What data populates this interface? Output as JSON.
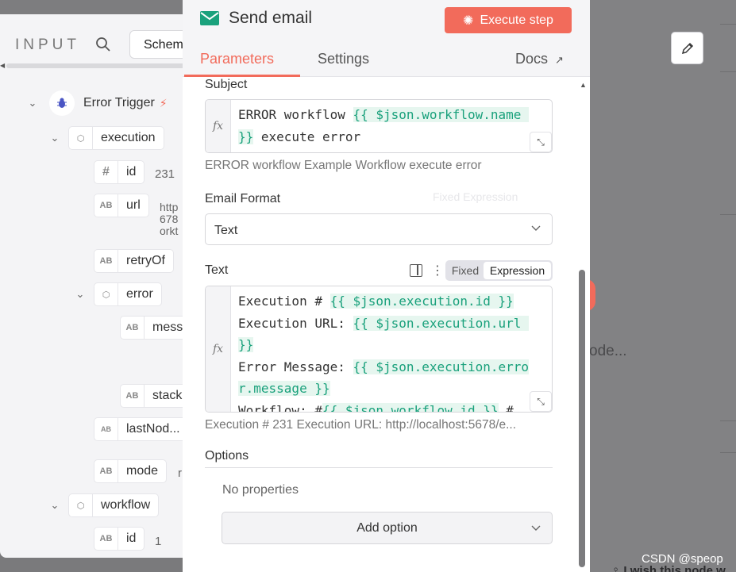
{
  "input_panel": {
    "title": "INPUT",
    "schema_tab": "Schema",
    "trigger": {
      "label": "Error Trigger"
    },
    "tree": [
      {
        "label": "execution",
        "type": "object"
      },
      {
        "label": "id",
        "type": "number",
        "value": "231"
      },
      {
        "label": "url",
        "type": "string",
        "value_lines": [
          "http",
          "678",
          "orkt"
        ]
      },
      {
        "label": "retryOf",
        "type": "string"
      },
      {
        "label": "error",
        "type": "object"
      },
      {
        "label": "message",
        "type": "string"
      },
      {
        "label": "stack",
        "type": "string"
      },
      {
        "label": "lastNod...",
        "type": "string"
      },
      {
        "label": "mode",
        "type": "string",
        "value": "r"
      },
      {
        "label": "workflow",
        "type": "object"
      },
      {
        "label": "id",
        "type": "string",
        "value": "1"
      }
    ]
  },
  "modal": {
    "title": "Send email",
    "execute_label": "Execute step",
    "tabs": {
      "parameters": "Parameters",
      "settings": "Settings",
      "docs": "Docs"
    },
    "subject": {
      "label": "Subject",
      "line1_plain": "ERROR workflow ",
      "line1_expr": "{{ $json.workflow.name ",
      "line2_expr": "}}",
      "line2_plain": " execute error",
      "preview": "ERROR workflow Example Workflow execute error"
    },
    "email_format": {
      "label": "Email Format",
      "value": "Text",
      "ghost_toggle": "Fixed  Expression"
    },
    "text": {
      "label": "Text",
      "toggle_fixed": "Fixed",
      "toggle_expression": "Expression",
      "lines": [
        {
          "plain": "Execution # ",
          "expr": "{{ $json.execution.id }}"
        },
        {
          "plain": "Execution URL: ",
          "expr": "{{ $json.execution.url "
        },
        {
          "plain": "",
          "expr": "}}"
        },
        {
          "plain": "Error Message: ",
          "expr": "{{ $json.execution.erro"
        },
        {
          "plain": "",
          "expr": "r.message }}"
        },
        {
          "plain": "Workflow: #",
          "expr": "{{ $json.workflow.id }}",
          "tail": " #"
        }
      ],
      "preview": "Execution # 231 Execution URL: http://localhost:5678/e..."
    },
    "options": {
      "title": "Options",
      "empty": "No properties",
      "add_label": "Add option"
    }
  },
  "canvas": {
    "node_text": "ode...",
    "watermark": "CSDN @speop",
    "bottom_text": "I wish this node w"
  },
  "colors": {
    "accent": "#f26b5b",
    "expression_green": "#1aa17c",
    "expression_bg": "#e6f6ef"
  }
}
